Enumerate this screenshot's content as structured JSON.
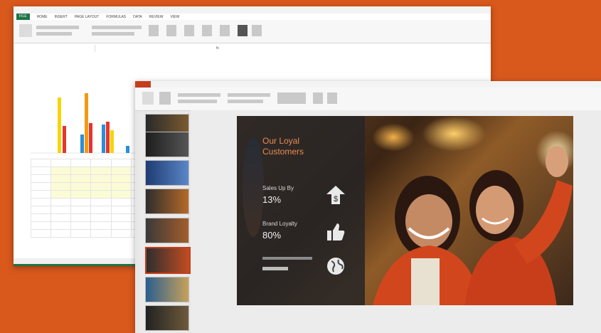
{
  "excel": {
    "tabs": [
      "FILE",
      "HOME",
      "INSERT",
      "PAGE LAYOUT",
      "FORMULAS",
      "DATA",
      "REVIEW",
      "VIEW"
    ],
    "sheet_title": "",
    "brand_color": "#217346",
    "chart_colors": [
      "#f7d40a",
      "#e8352b",
      "#2b8fd6",
      "#f39a11"
    ]
  },
  "powerpoint": {
    "brand_color": "#c43e1c",
    "slide": {
      "title_line1": "Our Loyal",
      "title_line2": "Customers",
      "stats": [
        {
          "label": "Sales Up By",
          "value": "13%",
          "icon": "dollar-up-arrow-icon"
        },
        {
          "label": "Brand Loyalty",
          "value": "80%",
          "icon": "thumbs-up-icon"
        },
        {
          "label": "",
          "value": "",
          "icon": "globe-icon"
        }
      ]
    },
    "thumbnail_count": 8
  },
  "background_color": "#d9581c"
}
